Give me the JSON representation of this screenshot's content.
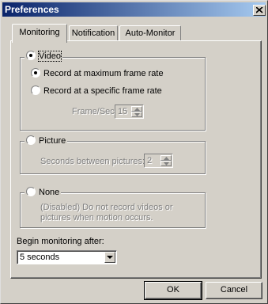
{
  "window": {
    "title": "Preferences"
  },
  "tabs": [
    {
      "label": "Monitoring",
      "active": true
    },
    {
      "label": "Notification",
      "active": false
    },
    {
      "label": "Auto-Monitor",
      "active": false
    }
  ],
  "video": {
    "label": "Video",
    "selected": true,
    "options": [
      {
        "label": "Record at maximum frame rate",
        "selected": true
      },
      {
        "label": "Record at a specific frame rate",
        "selected": false
      }
    ],
    "frame_rate_label": "Frame/Sec:",
    "frame_rate_value": "15"
  },
  "picture": {
    "label": "Picture",
    "selected": false,
    "interval_label": "Seconds between pictures:",
    "interval_value": "2"
  },
  "none": {
    "label": "None",
    "selected": false,
    "description": "(Disabled) Do not record videos or pictures when motion occurs."
  },
  "begin_monitoring": {
    "label": "Begin monitoring after:",
    "value": "5 seconds"
  },
  "buttons": {
    "ok": "OK",
    "cancel": "Cancel"
  }
}
